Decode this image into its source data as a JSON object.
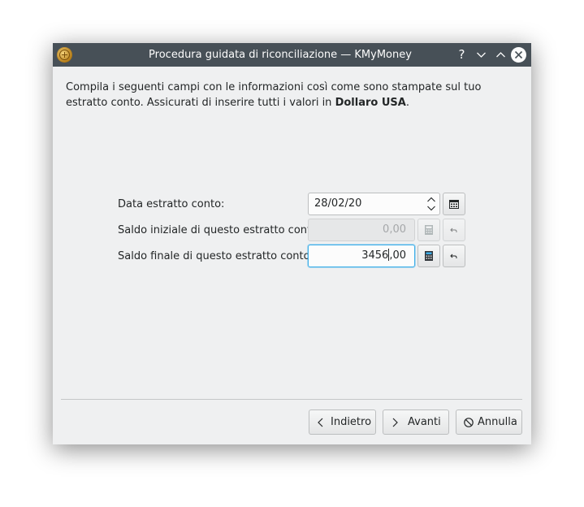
{
  "window": {
    "title": "Procedura guidata di riconciliazione — KMyMoney",
    "help_symbol": "?"
  },
  "intro": {
    "text_before": "Compila i seguenti campi con le informazioni così come sono stampate sul tuo estratto conto. Assicurati di inserire tutti i valori in ",
    "currency": "Dollaro USA",
    "text_after": "."
  },
  "form": {
    "date_label": "Data estratto conto:",
    "date_value": "28/02/20",
    "opening_label": "Saldo iniziale di questo estratto conto:",
    "opening_value": "0,00",
    "ending_label": "Saldo finale di questo estratto conto:",
    "ending_value_before_cursor": "3456",
    "ending_value_after_cursor": ",00"
  },
  "buttons": {
    "back": "Indietro",
    "next": "Avanti",
    "cancel": "Annulla"
  },
  "icons": {
    "app": "kmymoney-icon",
    "help": "help-icon",
    "minimize": "minimize-icon",
    "maximize": "maximize-icon",
    "close": "close-icon",
    "calendar": "calendar-icon",
    "calculator": "calculator-icon",
    "reset": "undo-icon",
    "back": "chevron-left-icon",
    "next": "chevron-right-icon",
    "cancel": "cancel-icon"
  },
  "colors": {
    "titlebar": "#475057",
    "window_bg": "#eff0f1",
    "focus": "#3daee9"
  }
}
